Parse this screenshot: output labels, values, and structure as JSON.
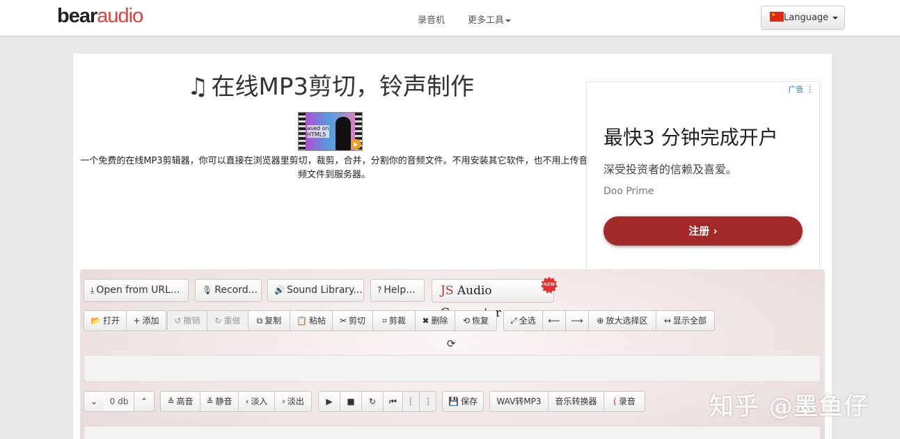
{
  "navbar": {
    "logo_part1": "bear",
    "logo_part2": "audio",
    "links": [
      "录音机",
      "更多工具"
    ],
    "language_label": "Language"
  },
  "main": {
    "title": "在线MP3剪切，铃声制作",
    "video_text": "ased on\nHTML5",
    "description": "一个免费的在线MP3剪辑器，你可以直接在浏览器里剪切，裁剪，合并，分割你的音频文件。不用安装其它软件，也不用上传音频文件到服务器。"
  },
  "ad": {
    "tag": "广告",
    "title": "最快3 分钟完成开户",
    "subtitle": "深受投资者的信赖及喜爱。",
    "brand": "Doo Prime",
    "button": "注册"
  },
  "toolbar_top": {
    "open_url": "Open from URL...",
    "record": "Record...",
    "sound_library": "Sound Library...",
    "help": "Help...",
    "converter_js": "JS",
    "converter_name": "Audio Converter",
    "new_badge": "NEW"
  },
  "toolbar_edit": {
    "open": "打开",
    "add": "添加",
    "undo": "撤销",
    "redo": "重做",
    "copy": "复制",
    "paste": "粘帖",
    "cut": "剪切",
    "crop": "剪裁",
    "delete": "删除",
    "restore": "恢复",
    "select_all": "全选",
    "zoom_selection": "放大选择区",
    "show_all": "显示全部"
  },
  "toolbar_bottom": {
    "volume": "0 db",
    "treble": "高音",
    "mute": "静音",
    "fade_in": "淡入",
    "fade_out": "淡出",
    "bracket_open": "[",
    "bracket_close": "]",
    "save": "保存",
    "wav_to_mp3": "WAV转MP3",
    "music_converter": "音乐转换器",
    "record_cn": "录音"
  },
  "watermark": "知乎 @墨鱼仔"
}
